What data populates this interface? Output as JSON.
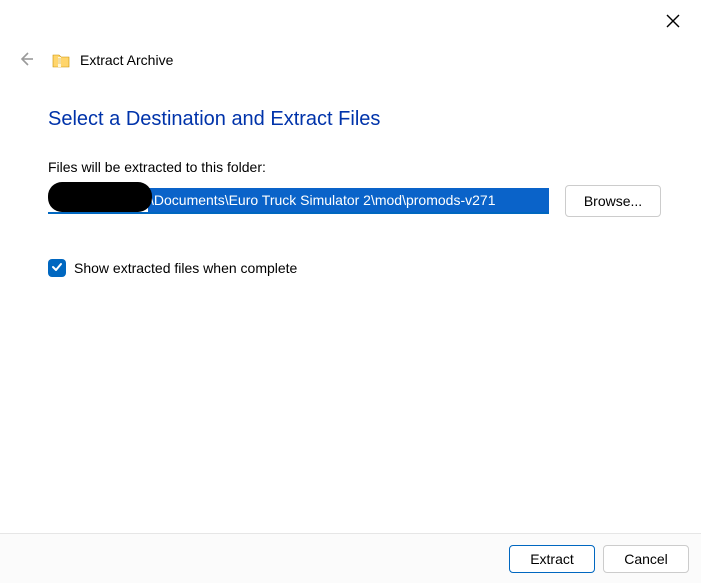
{
  "window": {
    "title": "Extract Archive"
  },
  "heading": "Select a Destination and Extract Files",
  "path_label": "Files will be extracted to this folder:",
  "path_value": "\\Documents\\Euro Truck Simulator 2\\mod\\promods-v271",
  "browse_label": "Browse...",
  "checkbox": {
    "checked": true,
    "label": "Show extracted files when complete"
  },
  "footer": {
    "extract": "Extract",
    "cancel": "Cancel"
  }
}
